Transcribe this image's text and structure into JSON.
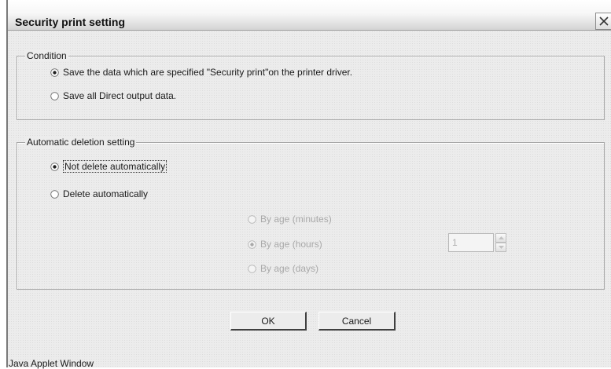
{
  "window": {
    "title": "Security print setting",
    "status_text": "Java Applet Window"
  },
  "condition": {
    "legend": "Condition",
    "options": [
      {
        "label": "Save the data which are specified \"Security print\"on the printer driver.",
        "selected": true
      },
      {
        "label": "Save all Direct output data.",
        "selected": false
      }
    ]
  },
  "deletion": {
    "legend": "Automatic deletion setting",
    "options": [
      {
        "label": "Not delete automatically",
        "selected": true
      },
      {
        "label": "Delete automatically",
        "selected": false
      }
    ],
    "sub_options": [
      {
        "label": "By age (minutes)",
        "selected": false,
        "enabled": false
      },
      {
        "label": "By age (hours)",
        "selected": true,
        "enabled": false
      },
      {
        "label": "By age (days)",
        "selected": false,
        "enabled": false
      }
    ],
    "spinner_value": "1"
  },
  "buttons": {
    "ok_label": "OK",
    "cancel_label": "Cancel"
  }
}
